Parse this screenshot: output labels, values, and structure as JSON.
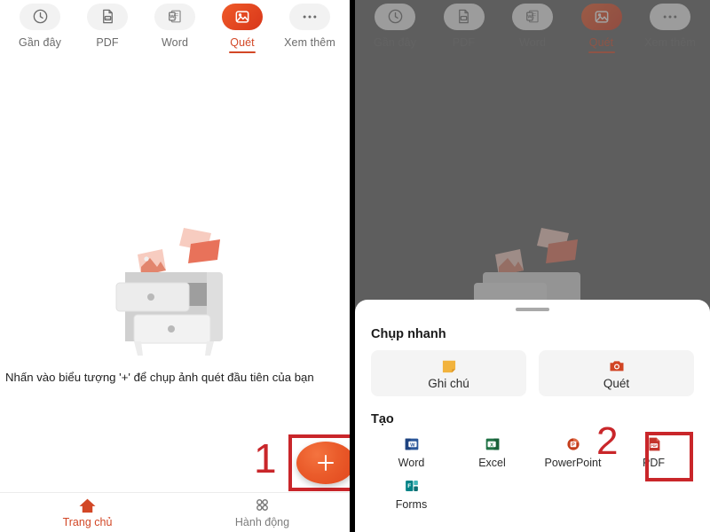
{
  "app": {
    "accent_orange": "#d24726",
    "annotation_red": "#c9262a",
    "scrim_gray": "#5e5e5e"
  },
  "tabbar": {
    "items": [
      {
        "label": "Gần đây",
        "icon": "clock-icon",
        "active": false
      },
      {
        "label": "PDF",
        "icon": "pdf-file-icon",
        "active": false
      },
      {
        "label": "Word",
        "icon": "word-doc-icon",
        "active": false
      },
      {
        "label": "Quét",
        "icon": "image-scan-icon",
        "active": true
      },
      {
        "label": "Xem thêm",
        "icon": "ellipsis-icon",
        "active": false
      }
    ]
  },
  "left_panel": {
    "illustration_name": "empty-state-cabinet-illustration",
    "caption": "Nhấn vào biểu tượng '+' để chụp ảnh quét đầu tiên của bạn",
    "fab_label": "+",
    "annotation": "1"
  },
  "bottom_nav": {
    "items": [
      {
        "label": "Trang chủ",
        "icon": "home-icon",
        "active": true
      },
      {
        "label": "Hành động",
        "icon": "grid-dots-icon",
        "active": false
      }
    ]
  },
  "right_panel": {
    "annotation": "2",
    "sheet": {
      "quick_title": "Chụp nhanh",
      "quick_items": [
        {
          "label": "Ghi chú",
          "icon": "sticky-note-icon",
          "color": "#f2b33d"
        },
        {
          "label": "Quét",
          "icon": "camera-icon",
          "color": "#d14524"
        }
      ],
      "create_title": "Tạo",
      "create_items": [
        {
          "label": "Word",
          "icon": "word-icon",
          "color": "#2b579a"
        },
        {
          "label": "Excel",
          "icon": "excel-icon",
          "color": "#217346"
        },
        {
          "label": "PowerPoint",
          "icon": "powerpoint-icon",
          "color": "#c43e1c"
        },
        {
          "label": "PDF",
          "icon": "pdf-icon",
          "color": "#c4342b"
        },
        {
          "label": "Forms",
          "icon": "forms-icon",
          "color": "#038387"
        }
      ]
    }
  }
}
